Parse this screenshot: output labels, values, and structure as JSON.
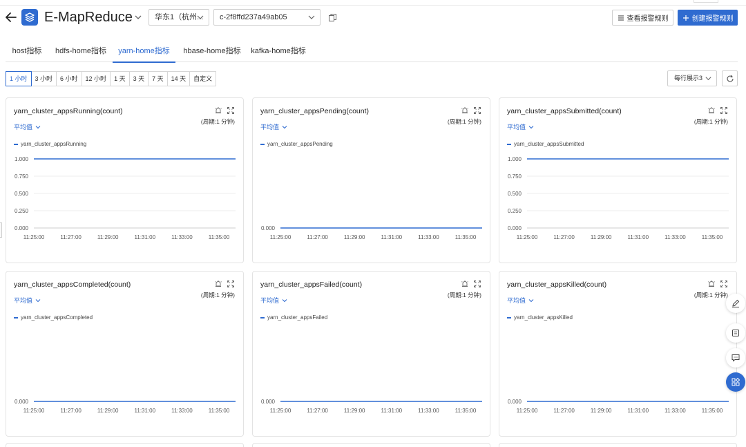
{
  "header": {
    "title": "E-MapReduce",
    "region_select": "华东1（杭州...",
    "cluster_select": "c-2f8ffd237a49ab05",
    "view_rules_label": "查看报警规则",
    "create_rule_label": "创建报警规则"
  },
  "tabs": [
    {
      "label": "host指标",
      "active": false
    },
    {
      "label": "hdfs-home指标",
      "active": false
    },
    {
      "label": "yarn-home指标",
      "active": true
    },
    {
      "label": "hbase-home指标",
      "active": false
    },
    {
      "label": "kafka-home指标",
      "active": false
    }
  ],
  "time_ranges": [
    {
      "label": "1 小时",
      "active": true
    },
    {
      "label": "3 小时",
      "active": false
    },
    {
      "label": "6 小时",
      "active": false
    },
    {
      "label": "12 小时",
      "active": false
    },
    {
      "label": "1 天",
      "active": false
    },
    {
      "label": "3 天",
      "active": false
    },
    {
      "label": "7 天",
      "active": false
    },
    {
      "label": "14 天",
      "active": false
    },
    {
      "label": "自定义",
      "active": false
    }
  ],
  "per_row_select": "每行展示3",
  "colors": {
    "accent": "#2f6bd0"
  },
  "icons": [
    "back-arrow-icon",
    "emr-logo-icon",
    "chevron-down-icon",
    "copy-icon",
    "list-icon",
    "plus-icon",
    "refresh-icon",
    "alarm-bell-icon",
    "fullscreen-icon",
    "edit-icon",
    "book-icon",
    "chat-icon",
    "apps-grid-icon"
  ],
  "chart_data": [
    {
      "type": "line",
      "title": "yarn_cluster_appsRunning(count)",
      "aggregation": "平均值",
      "period": "(周期:1 分钟)",
      "x": [
        "11:25:00",
        "11:27:00",
        "11:29:00",
        "11:31:00",
        "11:33:00",
        "11:35:00"
      ],
      "yticks": [
        "1.000",
        "0.750",
        "0.500",
        "0.250",
        "0.000"
      ],
      "ylim": [
        0,
        1
      ],
      "series": [
        {
          "name": "yarn_cluster_appsRunning",
          "values": [
            1,
            1,
            1,
            1,
            1,
            1
          ]
        }
      ]
    },
    {
      "type": "line",
      "title": "yarn_cluster_appsPending(count)",
      "aggregation": "平均值",
      "period": "(周期:1 分钟)",
      "x": [
        "11:25:00",
        "11:27:00",
        "11:29:00",
        "11:31:00",
        "11:33:00",
        "11:35:00"
      ],
      "yticks": [
        "0.000"
      ],
      "ylim": [
        0,
        1
      ],
      "series": [
        {
          "name": "yarn_cluster_appsPending",
          "values": [
            0,
            0,
            0,
            0,
            0,
            0
          ]
        }
      ]
    },
    {
      "type": "line",
      "title": "yarn_cluster_appsSubmitted(count)",
      "aggregation": "平均值",
      "period": "(周期:1 分钟)",
      "x": [
        "11:25:00",
        "11:27:00",
        "11:29:00",
        "11:31:00",
        "11:33:00",
        "11:35:00"
      ],
      "yticks": [
        "1.000",
        "0.750",
        "0.500",
        "0.250",
        "0.000"
      ],
      "ylim": [
        0,
        1
      ],
      "series": [
        {
          "name": "yarn_cluster_appsSubmitted",
          "values": [
            1,
            1,
            1,
            1,
            1,
            1
          ]
        }
      ]
    },
    {
      "type": "line",
      "title": "yarn_cluster_appsCompleted(count)",
      "aggregation": "平均值",
      "period": "(周期:1 分钟)",
      "x": [
        "11:25:00",
        "11:27:00",
        "11:29:00",
        "11:31:00",
        "11:33:00",
        "11:35:00"
      ],
      "yticks": [
        "0.000"
      ],
      "ylim": [
        0,
        1
      ],
      "series": [
        {
          "name": "yarn_cluster_appsCompleted",
          "values": [
            0,
            0,
            0,
            0,
            0,
            0
          ]
        }
      ]
    },
    {
      "type": "line",
      "title": "yarn_cluster_appsFailed(count)",
      "aggregation": "平均值",
      "period": "(周期:1 分钟)",
      "x": [
        "11:25:00",
        "11:27:00",
        "11:29:00",
        "11:31:00",
        "11:33:00",
        "11:35:00"
      ],
      "yticks": [
        "0.000"
      ],
      "ylim": [
        0,
        1
      ],
      "series": [
        {
          "name": "yarn_cluster_appsFailed",
          "values": [
            0,
            0,
            0,
            0,
            0,
            0
          ]
        }
      ]
    },
    {
      "type": "line",
      "title": "yarn_cluster_appsKilled(count)",
      "aggregation": "平均值",
      "period": "(周期:1 分钟)",
      "x": [
        "11:25:00",
        "11:27:00",
        "11:29:00",
        "11:31:00",
        "11:33:00",
        "11:35:00"
      ],
      "yticks": [
        "0.000"
      ],
      "ylim": [
        0,
        1
      ],
      "series": [
        {
          "name": "yarn_cluster_appsKilled",
          "values": [
            0,
            0,
            0,
            0,
            0,
            0
          ]
        }
      ]
    }
  ]
}
